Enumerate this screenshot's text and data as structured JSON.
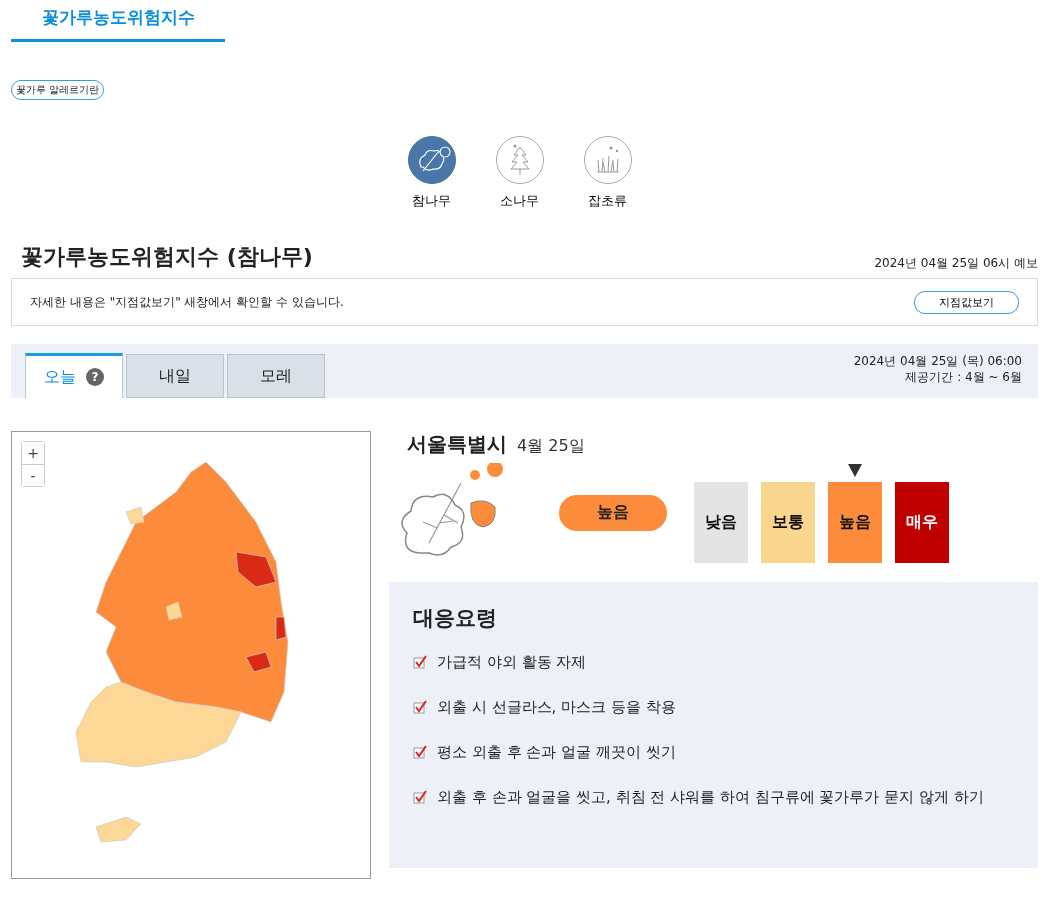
{
  "page_tab": {
    "label": "꽃가루농도위험지수",
    "selected": true
  },
  "alert_chip": "꽃가루 알레르기란",
  "species": [
    {
      "label": "참나무",
      "kind": "oak",
      "selected": true
    },
    {
      "label": "소나무",
      "kind": "pine",
      "selected": false
    },
    {
      "label": "잡초류",
      "kind": "weed",
      "selected": false
    }
  ],
  "heading": "꽃가루농도위험지수 (참나무)",
  "forecast_time": "2024년 04월 25일 06시 예보",
  "notice": {
    "text": "자세한 내용은 \"지점값보기\" 새창에서 확인할 수 있습니다.",
    "button": "지점값보기"
  },
  "day_tabs": [
    {
      "label": "오늘",
      "selected": true,
      "help": "?"
    },
    {
      "label": "내일",
      "selected": false
    },
    {
      "label": "모레",
      "selected": false
    }
  ],
  "issued": "2024년 04월 25일 (목) 06:00",
  "period": "제공기간 : 4월 ~ 6월",
  "map": {
    "zoom_in": "+",
    "zoom_out": "-"
  },
  "region": "서울특별시",
  "date": "4월 25일",
  "current_level": "높음",
  "levels": [
    {
      "label": "낮음",
      "color": "#e4e4e4",
      "selected": false
    },
    {
      "label": "보통",
      "color": "#f9d68e",
      "selected": false
    },
    {
      "label": "높음",
      "color": "#fc8c3c",
      "selected": true
    },
    {
      "label": "매우",
      "color": "#c00000",
      "selected": false
    }
  ],
  "guidance": {
    "title": "대응요령",
    "items": [
      "가급적 야외 활동 자제",
      "외출 시 선글라스, 마스크 등을 착용",
      "평소 외출 후 손과 얼굴 깨끗이 씻기",
      "외출 후 손과 얼굴을 씻고, 취침 전 샤워를 하여 침구류에 꽃가루가 묻지 않게 하기"
    ]
  }
}
